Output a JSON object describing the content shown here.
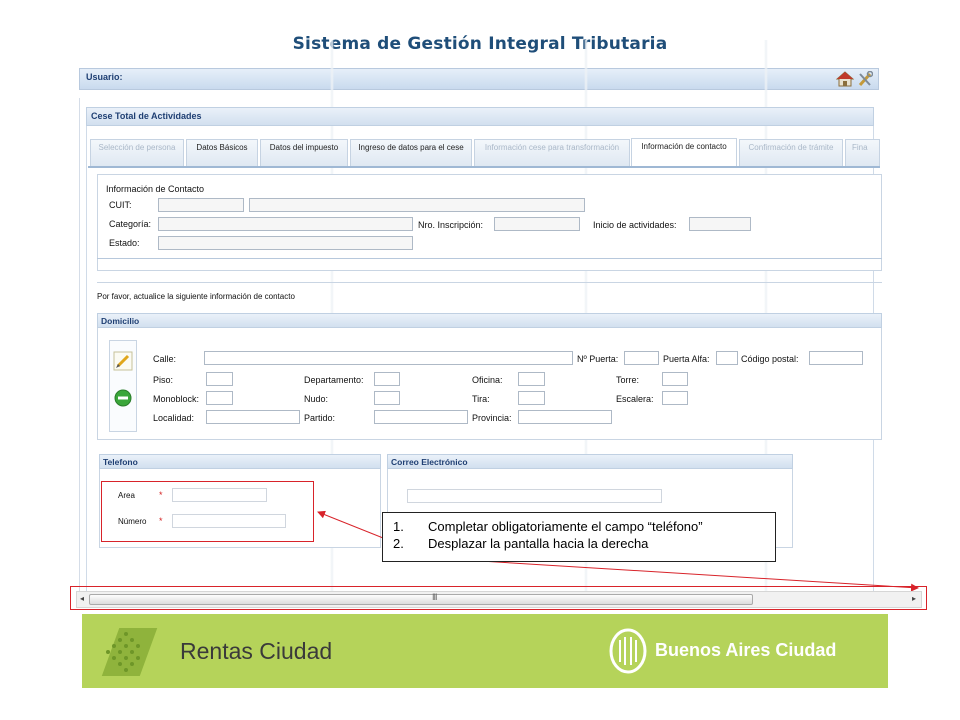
{
  "app": {
    "title": "Sistema de Gestión Integral Tributaria"
  },
  "userbar": {
    "label": "Usuario:"
  },
  "section": {
    "title": "Cese Total de Actividades"
  },
  "tabs": [
    {
      "label": "Selección de persona",
      "state": "disabled"
    },
    {
      "label": "Datos Básicos",
      "state": "enabled"
    },
    {
      "label": "Datos del impuesto",
      "state": "enabled"
    },
    {
      "label": "Ingreso de datos para el cese",
      "state": "enabled"
    },
    {
      "label": "Información cese para transformación",
      "state": "disabled"
    },
    {
      "label": "Información de contacto",
      "state": "active"
    },
    {
      "label": "Confirmación de trámite",
      "state": "disabled"
    },
    {
      "label": "Fina",
      "state": "disabled"
    }
  ],
  "contact_info": {
    "title": "Información de Contacto",
    "cuit_label": "CUIT:",
    "categoria_label": "Categoría:",
    "nro_inscripcion_label": "Nro. Inscripción:",
    "inicio_label": "Inicio de actividades:",
    "estado_label": "Estado:"
  },
  "note": "Por favor, actualice la siguiente información de contacto",
  "domicilio": {
    "title": "Domicilio",
    "calle": "Calle:",
    "nro_puerta": "Nº Puerta:",
    "puerta_alfa": "Puerta Alfa:",
    "codigo_postal": "Código postal:",
    "piso": "Piso:",
    "departamento": "Departamento:",
    "oficina": "Oficina:",
    "torre": "Torre:",
    "monoblock": "Monoblock:",
    "nudo": "Nudo:",
    "tira": "Tira:",
    "escalera": "Escalera:",
    "localidad": "Localidad:",
    "partido": "Partido:",
    "provincia": "Provincia:"
  },
  "telefono": {
    "title": "Telefono",
    "area_label": "Area",
    "numero_label": "Número",
    "required_mark": "*"
  },
  "correo": {
    "title": "Correo Electrónico"
  },
  "callout": {
    "items": [
      {
        "num": "1.",
        "text": "Completar obligatoriamente el campo “teléfono”"
      },
      {
        "num": "2.",
        "text": "Desplazar la pantalla hacia la derecha"
      }
    ]
  },
  "scrollbar": {
    "left_arrow": "◂",
    "right_arrow": "▸",
    "grip": "III"
  },
  "footer": {
    "left_brand": "Rentas Ciudad",
    "right_brand": "Buenos Aires Ciudad"
  },
  "colors": {
    "annotation": "#d8232a",
    "banner": "#b5d35a",
    "header_text": "#1f3f73",
    "title": "#1f4e79"
  }
}
